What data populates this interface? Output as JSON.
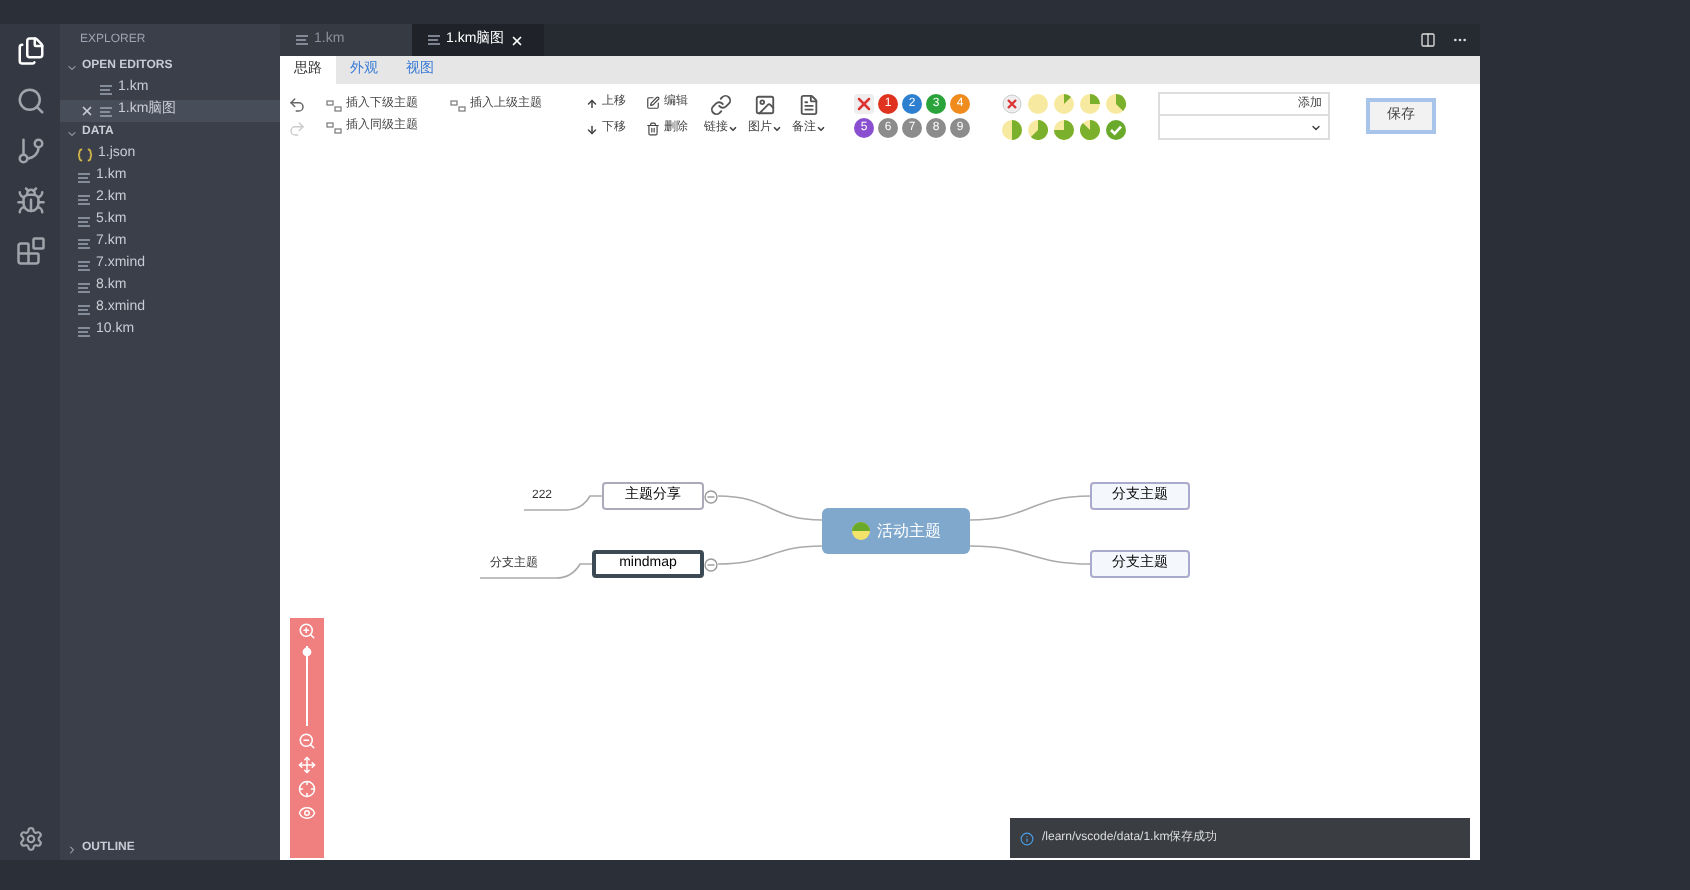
{
  "activity_bar": [
    {
      "kind": "files",
      "selected": true
    },
    {
      "kind": "search",
      "selected": false
    },
    {
      "kind": "source-control",
      "selected": false
    },
    {
      "kind": "debug",
      "selected": false
    },
    {
      "kind": "extensions",
      "selected": false
    }
  ],
  "sidebar": {
    "title": "EXPLORER",
    "sections": [
      {
        "title": "OPEN EDITORS",
        "expanded": true,
        "items": [
          {
            "label": "1.km",
            "kind": "file",
            "selected": false
          },
          {
            "label": "1.km脑图",
            "kind": "file",
            "selected": true
          }
        ]
      },
      {
        "title": "DATA",
        "expanded": true,
        "items": [
          {
            "label": "1.json",
            "kind": "json",
            "selected": false
          },
          {
            "label": "1.km",
            "kind": "file",
            "selected": false
          },
          {
            "label": "2.km",
            "kind": "file",
            "selected": false
          },
          {
            "label": "5.km",
            "kind": "file",
            "selected": false
          },
          {
            "label": "7.km",
            "kind": "file",
            "selected": false
          },
          {
            "label": "7.xmind",
            "kind": "file",
            "selected": false
          },
          {
            "label": "8.km",
            "kind": "file",
            "selected": false
          },
          {
            "label": "8.xmind",
            "kind": "file",
            "selected": false
          },
          {
            "label": "10.km",
            "kind": "file",
            "selected": false
          }
        ]
      },
      {
        "title": "OUTLINE",
        "expanded": false
      }
    ]
  },
  "editor_tabs": [
    {
      "label": "1.km",
      "selected": false
    },
    {
      "label": "1.km脑图",
      "selected": true
    }
  ],
  "mindmap_tabs": [
    {
      "label": "思路",
      "selected": true
    },
    {
      "label": "外观",
      "selected": false
    },
    {
      "label": "视图",
      "selected": false
    }
  ],
  "history": [
    {
      "kind": "undo",
      "disabled": false
    },
    {
      "kind": "redo",
      "disabled": true
    }
  ],
  "insert_buttons": [
    {
      "label": "插入下级主题"
    },
    {
      "label": "插入上级主题"
    },
    {
      "label": "插入同级主题"
    }
  ],
  "move_buttons": [
    {
      "label": "上移"
    },
    {
      "label": "下移"
    }
  ],
  "edit_buttons": [
    {
      "label": "编辑"
    },
    {
      "label": "删除"
    }
  ],
  "menu_buttons": [
    {
      "label": "链接"
    },
    {
      "label": "图片"
    },
    {
      "label": "备注"
    }
  ],
  "priority": [
    {
      "kind": "clear"
    },
    {
      "kind": "number",
      "label": "1",
      "color": "#e0331f"
    },
    {
      "kind": "number",
      "label": "2",
      "color": "#2f7fd0"
    },
    {
      "kind": "number",
      "label": "3",
      "color": "#2aa33a"
    },
    {
      "kind": "number",
      "label": "4",
      "color": "#f08c1e"
    },
    {
      "kind": "number",
      "label": "5",
      "color": "#8a4fd0"
    },
    {
      "kind": "number",
      "label": "6",
      "color": "#8c8c8c"
    },
    {
      "kind": "number",
      "label": "7",
      "color": "#8c8c8c"
    },
    {
      "kind": "number",
      "label": "8",
      "color": "#8c8c8c"
    },
    {
      "kind": "number",
      "label": "9",
      "color": "#8c8c8c"
    }
  ],
  "add_button": "添加",
  "save_button": "保存",
  "mindmap": {
    "root": {
      "label": "活动主题"
    },
    "left": [
      {
        "label": "主题分享",
        "selected": false,
        "children": [
          {
            "label": "222"
          }
        ]
      },
      {
        "label": "mindmap",
        "selected": true,
        "children": [
          {
            "label": "分支主题"
          }
        ]
      }
    ],
    "right": [
      {
        "label": "分支主题",
        "selected": false
      },
      {
        "label": "分支主题",
        "selected": false
      }
    ]
  },
  "notification": {
    "message": "/learn/vscode/data/1.km保存成功"
  }
}
